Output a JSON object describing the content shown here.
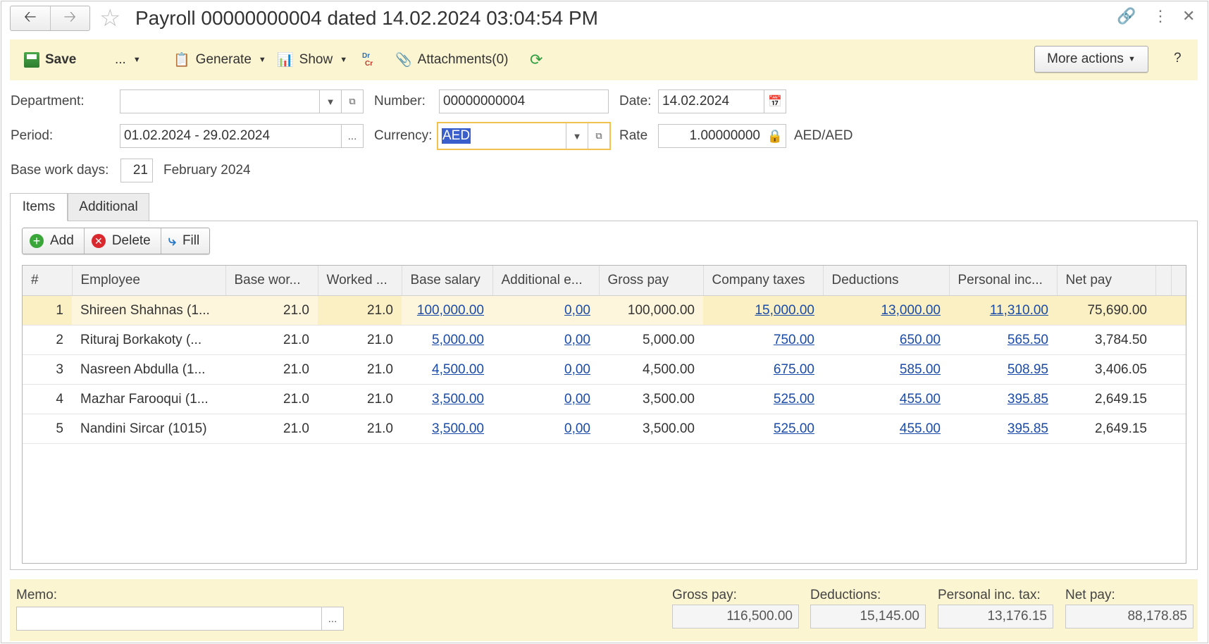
{
  "window": {
    "title": "Payroll 00000000004 dated 14.02.2024 03:04:54 PM",
    "back_icon": "arrow-left-icon",
    "forward_icon": "arrow-right-icon",
    "favorite_icon": "star-icon",
    "link_icon": "link-icon",
    "menu_icon": "kebab-menu-icon",
    "close_icon": "close-icon"
  },
  "toolbar": {
    "save": "Save",
    "more_dots": "...",
    "generate": "Generate",
    "show": "Show",
    "drcr_top": "Dr",
    "drcr_bottom": "Cr",
    "attachments": "Attachments(0)",
    "more_actions": "More actions",
    "help": "?"
  },
  "form": {
    "department_label": "Department:",
    "department_value": "",
    "number_label": "Number:",
    "number_value": "00000000004",
    "date_label": "Date:",
    "date_value": "14.02.2024",
    "period_label": "Period:",
    "period_value": "01.02.2024 - 29.02.2024",
    "period_btn": "...",
    "currency_label": "Currency:",
    "currency_value": "AED",
    "rate_label": "Rate",
    "rate_value": "1.00000000",
    "rate_unit": "AED/AED",
    "base_days_label": "Base work days:",
    "base_days_value": "21",
    "base_days_month": "February 2024"
  },
  "tabs": {
    "items": "Items",
    "additional": "Additional"
  },
  "commands": {
    "add": "Add",
    "delete": "Delete",
    "fill": "Fill"
  },
  "table": {
    "headers": [
      "#",
      "Employee",
      "Base wor...",
      "Worked ...",
      "Base salary",
      "Additional e...",
      "Gross pay",
      "Company taxes",
      "Deductions",
      "Personal inc...",
      "Net pay"
    ],
    "rows": [
      [
        "1",
        "Shireen Shahnas (1...",
        "21.0",
        "21.0",
        "100,000.00",
        "0,00",
        "100,000.00",
        "15,000.00",
        "13,000.00",
        "11,310.00",
        "75,690.00"
      ],
      [
        "2",
        "Rituraj Borkakoty (...",
        "21.0",
        "21.0",
        "5,000.00",
        "0,00",
        "5,000.00",
        "750.00",
        "650.00",
        "565.50",
        "3,784.50"
      ],
      [
        "3",
        "Nasreen Abdulla (1...",
        "21.0",
        "21.0",
        "4,500.00",
        "0,00",
        "4,500.00",
        "675.00",
        "585.00",
        "508.95",
        "3,406.05"
      ],
      [
        "4",
        "Mazhar Farooqui (1...",
        "21.0",
        "21.0",
        "3,500.00",
        "0,00",
        "3,500.00",
        "525.00",
        "455.00",
        "395.85",
        "2,649.15"
      ],
      [
        "5",
        "Nandini Sircar (1015)",
        "21.0",
        "21.0",
        "3,500.00",
        "0,00",
        "3,500.00",
        "525.00",
        "455.00",
        "395.85",
        "2,649.15"
      ]
    ]
  },
  "footer": {
    "memo_label": "Memo:",
    "memo_value": "",
    "memo_btn": "...",
    "gross_label": "Gross pay:",
    "gross_value": "116,500.00",
    "deductions_label": "Deductions:",
    "deductions_value": "15,145.00",
    "pit_label": "Personal inc. tax:",
    "pit_value": "13,176.15",
    "net_label": "Net pay:",
    "net_value": "88,178.85"
  },
  "colors": {
    "toolbar_bg": "#fbf5d2",
    "selected_row": "#fbf0c4",
    "link": "#1a4ba8",
    "focus_border": "#f2c14e"
  }
}
